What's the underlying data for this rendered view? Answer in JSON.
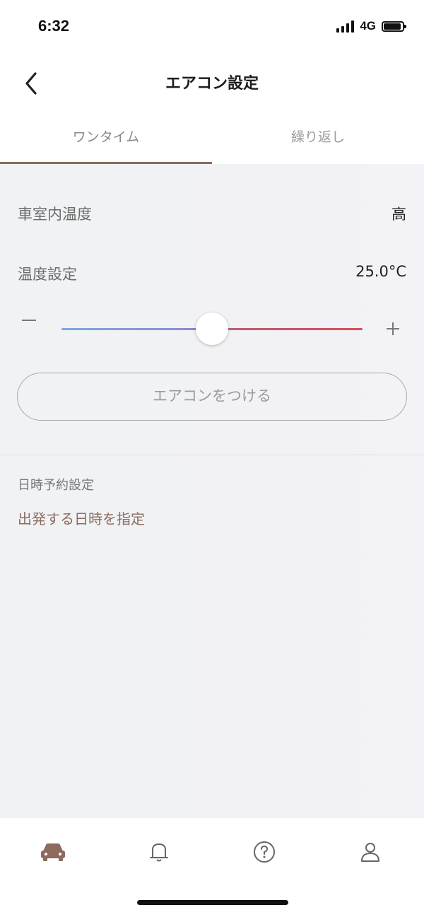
{
  "status_bar": {
    "time": "6:32",
    "network": "4G"
  },
  "header": {
    "title": "エアコン設定",
    "back_icon": "chevron-left-icon"
  },
  "tabs": [
    {
      "label": "ワンタイム",
      "active": true
    },
    {
      "label": "繰り返し",
      "active": false
    }
  ],
  "cabin_temp": {
    "label": "車室内温度",
    "value": "高"
  },
  "temp_setting": {
    "label": "温度設定",
    "value": "25.0°C"
  },
  "slider": {
    "value_fraction": 0.5,
    "minus_icon": "minus-icon",
    "plus_icon": "plus-icon"
  },
  "ac_button": {
    "label": "エアコンをつける"
  },
  "schedule": {
    "label": "日時予約設定",
    "link": "出発する日時を指定"
  },
  "bottom_nav": [
    {
      "icon": "car-icon",
      "active": true
    },
    {
      "icon": "bell-icon",
      "active": false
    },
    {
      "icon": "help-icon",
      "active": false
    },
    {
      "icon": "profile-icon",
      "active": false
    }
  ],
  "colors": {
    "accent": "#8c6a5c",
    "background": "#f2f2f5",
    "slider_cold": "#7fa6e6",
    "slider_hot": "#d84d5c"
  }
}
